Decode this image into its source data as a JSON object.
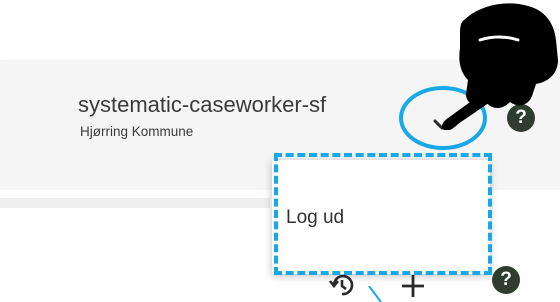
{
  "header": {
    "user_name": "systematic-caseworker-sf",
    "organization": "Hjørring Kommune",
    "chevron_icon": "chevron-down-icon",
    "help_icon_glyph": "?"
  },
  "dropdown": {
    "items": [
      {
        "label": "Log ud"
      }
    ]
  },
  "toolbar": {
    "history_icon": "history-icon",
    "add_icon": "add-icon",
    "help_icon_glyph": "?"
  },
  "colors": {
    "annotation": "#18a8e8",
    "help_icon_bg": "#2e3d2e",
    "header_bg": "#f5f5f5",
    "text": "#3a3a3a"
  }
}
